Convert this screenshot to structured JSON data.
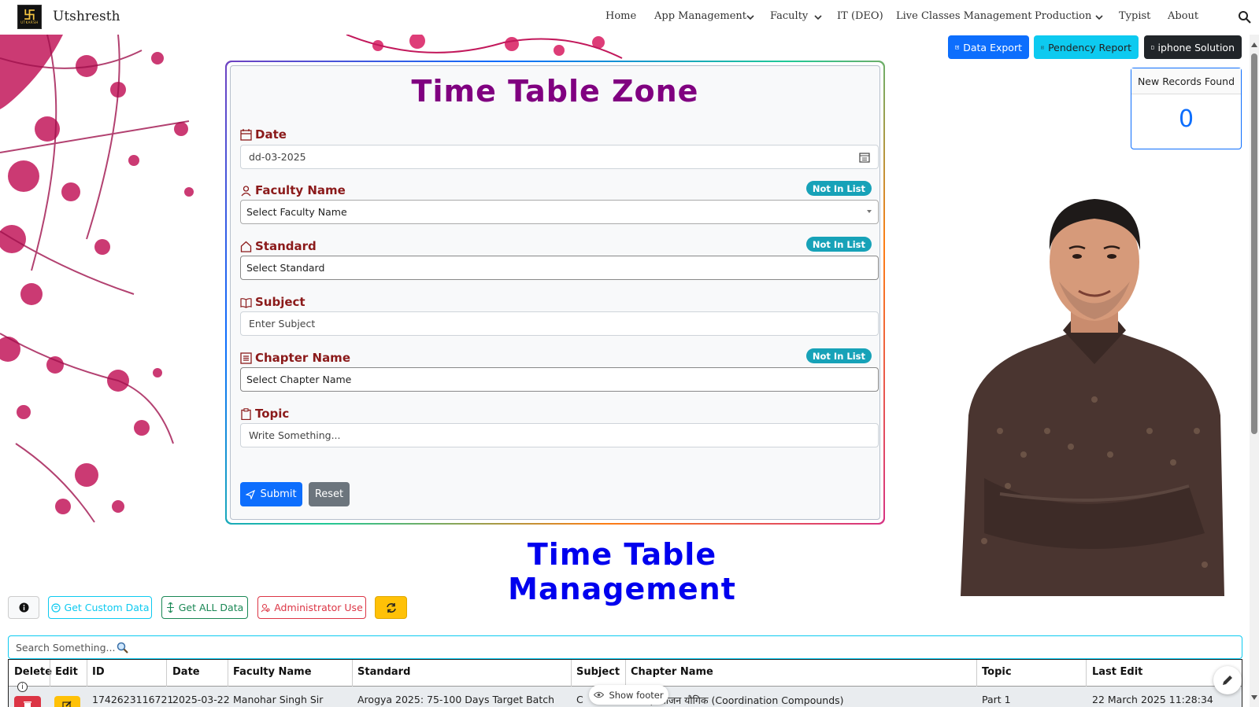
{
  "navbar": {
    "brand": "Utshresth",
    "logo_text": "UTKARSH",
    "items": [
      {
        "label": "Home",
        "dropdown": false
      },
      {
        "label": "App Management",
        "dropdown": true
      },
      {
        "label": "Faculty",
        "dropdown": true
      },
      {
        "label": "IT (DEO)",
        "dropdown": false
      },
      {
        "label": "Live Classes Management",
        "dropdown": false
      },
      {
        "label": "Production",
        "dropdown": true
      },
      {
        "label": "Typist",
        "dropdown": false
      },
      {
        "label": "About",
        "dropdown": false
      }
    ],
    "search_icon": "search-icon"
  },
  "top_buttons": {
    "data_export": "Data Export",
    "pendency_report": "Pendency Report",
    "iphone_solution": "iphone Solution"
  },
  "records": {
    "title": "New Records Found",
    "count": "0"
  },
  "form": {
    "title": "Time Table Zone",
    "date": {
      "label": "Date",
      "value": "dd-03-2025",
      "icon": "calendar-icon"
    },
    "faculty": {
      "label": "Faculty Name",
      "placeholder": "Select Faculty Name",
      "badge": "Not In List",
      "icon": "person-icon"
    },
    "standard": {
      "label": "Standard",
      "placeholder": "Select Standard",
      "badge": "Not In List",
      "icon": "house-icon"
    },
    "subject": {
      "label": "Subject",
      "placeholder": "Enter Subject",
      "icon": "book-icon"
    },
    "chapter": {
      "label": "Chapter Name",
      "placeholder": "Select Chapter Name",
      "badge": "Not In List",
      "icon": "list-icon"
    },
    "topic": {
      "label": "Topic",
      "placeholder": "Write Something...",
      "icon": "clipboard-icon"
    },
    "submit": "Submit",
    "reset": "Reset"
  },
  "management": {
    "title": "Time Table Management",
    "buttons": {
      "custom": "Get Custom Data",
      "all": "Get ALL Data",
      "admin": "Administrator Use"
    },
    "search_placeholder": "Search Something...",
    "table": {
      "headers": [
        "Delete",
        "Edit",
        "ID",
        "Date",
        "Faculty Name",
        "Standard",
        "Subject",
        "Chapter Name",
        "Topic",
        "Last Edit"
      ],
      "rows": [
        {
          "id": "1742623116721",
          "date": "2025-03-22",
          "faculty": "Manohar Singh Sir",
          "standard": "Arogya 2025: 75-100 Days Target Batch",
          "subject": "C",
          "chapter": "उपसहसंयोजन यौगिक (Coordination Compounds)",
          "topic": "Part 1",
          "last_edit": "22 March 2025 11:28:34"
        }
      ]
    },
    "show_footer": "Show footer"
  },
  "colors": {
    "primary": "#0d6efd",
    "info": "#0dcaf0",
    "dark": "#212529",
    "form_title": "#800080",
    "label": "#8b1a1a",
    "mgmt_title": "#0000ee",
    "badge": "#17a2b8"
  }
}
